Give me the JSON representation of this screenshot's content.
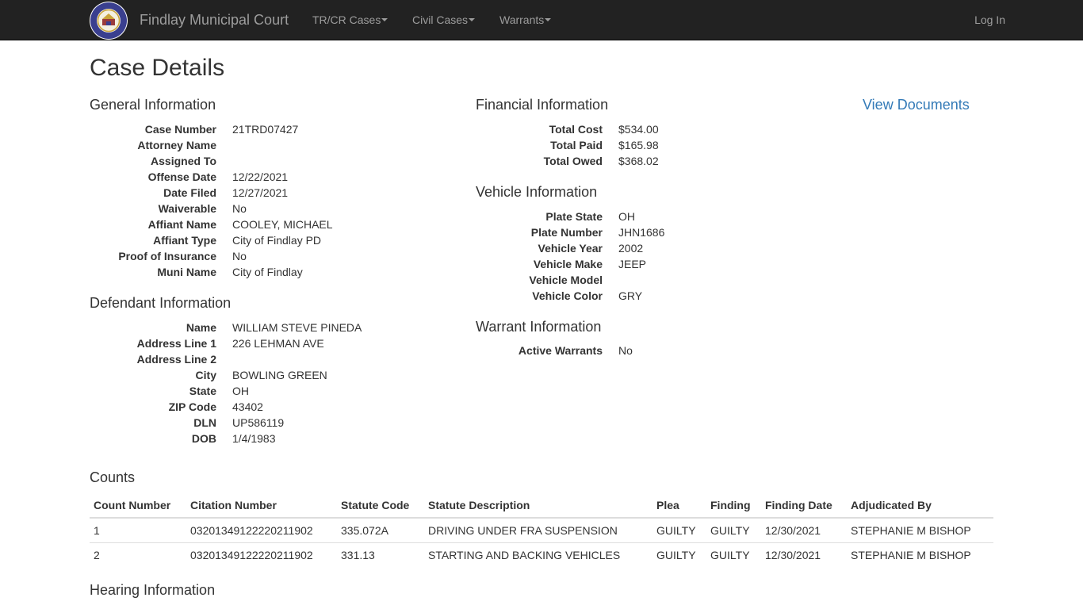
{
  "navbar": {
    "brand": "Findlay Municipal Court",
    "logo": {
      "ring_text": "CITY OF FINDLAY",
      "bottom_text": "OHIO",
      "icon": "city-seal-icon"
    },
    "menus": [
      {
        "label": "TR/CR Cases"
      },
      {
        "label": "Civil Cases"
      },
      {
        "label": "Warrants"
      }
    ],
    "login": "Log In"
  },
  "page": {
    "title": "Case Details"
  },
  "general": {
    "title": "General Information",
    "rows": [
      {
        "label": "Case Number",
        "value": "21TRD07427"
      },
      {
        "label": "Attorney Name",
        "value": ""
      },
      {
        "label": "Assigned To",
        "value": ""
      },
      {
        "label": "Offense Date",
        "value": "12/22/2021"
      },
      {
        "label": "Date Filed",
        "value": "12/27/2021"
      },
      {
        "label": "Waiverable",
        "value": "No"
      },
      {
        "label": "Affiant Name",
        "value": "COOLEY, MICHAEL"
      },
      {
        "label": "Affiant Type",
        "value": "City of Findlay PD"
      },
      {
        "label": "Proof of Insurance",
        "value": "No"
      },
      {
        "label": "Muni Name",
        "value": "City of Findlay"
      }
    ]
  },
  "defendant": {
    "title": "Defendant Information",
    "rows": [
      {
        "label": "Name",
        "value": "WILLIAM STEVE PINEDA"
      },
      {
        "label": "Address Line 1",
        "value": "226 LEHMAN AVE"
      },
      {
        "label": "Address Line 2",
        "value": ""
      },
      {
        "label": "City",
        "value": "BOWLING GREEN"
      },
      {
        "label": "State",
        "value": "OH"
      },
      {
        "label": "ZIP Code",
        "value": "43402"
      },
      {
        "label": "DLN",
        "value": "UP586119"
      },
      {
        "label": "DOB",
        "value": "1/4/1983"
      }
    ]
  },
  "financial": {
    "title": "Financial Information",
    "rows": [
      {
        "label": "Total Cost",
        "value": "$534.00"
      },
      {
        "label": "Total Paid",
        "value": "$165.98"
      },
      {
        "label": "Total Owed",
        "value": "$368.02"
      }
    ]
  },
  "documents": {
    "link": "View Documents"
  },
  "vehicle": {
    "title": "Vehicle Information",
    "rows": [
      {
        "label": "Plate State",
        "value": "OH"
      },
      {
        "label": "Plate Number",
        "value": "JHN1686"
      },
      {
        "label": "Vehicle Year",
        "value": "2002"
      },
      {
        "label": "Vehicle Make",
        "value": "JEEP"
      },
      {
        "label": "Vehicle Model",
        "value": ""
      },
      {
        "label": "Vehicle Color",
        "value": "GRY"
      }
    ]
  },
  "warrant": {
    "title": "Warrant Information",
    "rows": [
      {
        "label": "Active Warrants",
        "value": "No"
      }
    ]
  },
  "counts": {
    "title": "Counts",
    "columns": [
      "Count Number",
      "Citation Number",
      "Statute Code",
      "Statute Description",
      "Plea",
      "Finding",
      "Finding Date",
      "Adjudicated By"
    ],
    "rows": [
      [
        "1",
        "03201349122220211902",
        "335.072A",
        "DRIVING UNDER FRA SUSPENSION",
        "GUILTY",
        "GUILTY",
        "12/30/2021",
        "STEPHANIE M BISHOP"
      ],
      [
        "2",
        "03201349122220211902",
        "331.13",
        "STARTING AND BACKING VEHICLES",
        "GUILTY",
        "GUILTY",
        "12/30/2021",
        "STEPHANIE M BISHOP"
      ]
    ]
  },
  "hearing": {
    "title": "Hearing Information"
  },
  "colors": {
    "navbar_bg": "#222222",
    "nav_text": "#9d9d9d",
    "link": "#337ab7",
    "text": "#333333"
  }
}
